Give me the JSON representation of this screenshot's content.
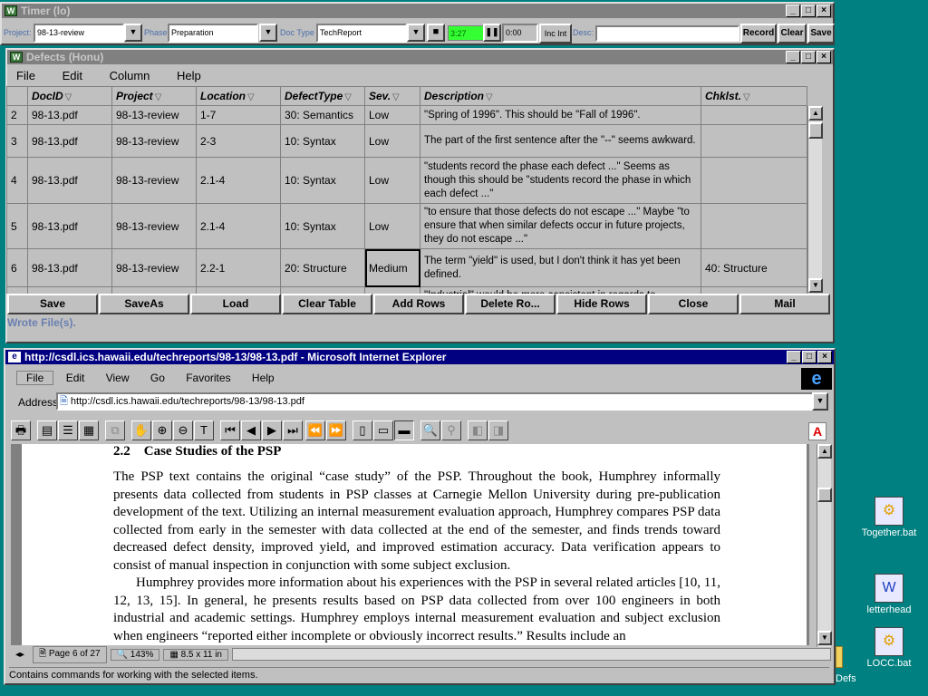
{
  "timer": {
    "title": "Timer (lo)",
    "project_label": "Project:",
    "project_value": "98-13-review",
    "phase_label": "Phase",
    "phase_value": "Preparation",
    "doctype_label": "Doc Type",
    "doctype_value": "TechReport",
    "elapsed": "3:27",
    "pause_time": "0:00",
    "inc_int": "Inc Int",
    "desc_label": "Desc:",
    "desc_value": "",
    "record": "Record",
    "clear": "Clear",
    "save": "Save"
  },
  "defects": {
    "title": "Defects (Honu)",
    "menu": [
      "File",
      "Edit",
      "Column",
      "Help"
    ],
    "columns": [
      "DocID",
      "Project",
      "Location",
      "DefectType",
      "Sev.",
      "Description",
      "Chklst."
    ],
    "rows": [
      {
        "n": "2",
        "doc": "98-13.pdf",
        "proj": "98-13-review",
        "loc": "1-7",
        "type": "30: Semantics",
        "sev": "Low",
        "desc": "\"Spring of 1996\".  This should be \"Fall of 1996\".",
        "chk": ""
      },
      {
        "n": "3",
        "doc": "98-13.pdf",
        "proj": "98-13-review",
        "loc": "2-3",
        "type": "10: Syntax",
        "sev": "Low",
        "desc": "The part of the first sentence after the \"--\" seems awkward.",
        "chk": ""
      },
      {
        "n": "4",
        "doc": "98-13.pdf",
        "proj": "98-13-review",
        "loc": "2.1-4",
        "type": "10: Syntax",
        "sev": "Low",
        "desc": "\"students record the phase each defect ...\"  Seems as though this should be \"students record the phase in which each defect ...\"",
        "chk": ""
      },
      {
        "n": "5",
        "doc": "98-13.pdf",
        "proj": "98-13-review",
        "loc": "2.1-4",
        "type": "10: Syntax",
        "sev": "Low",
        "desc": "\"to ensure that those defects do not escape ...\"   Maybe \"to ensure that when similar defects occur in future projects, they do not escape ...\"",
        "chk": ""
      },
      {
        "n": "6",
        "doc": "98-13.pdf",
        "proj": "98-13-review",
        "loc": "2.2-1",
        "type": "20: Structure",
        "sev": "Medium",
        "desc": "The term \"yield\" is used, but I don't think it has yet been defined.",
        "chk": "40: Structure"
      },
      {
        "n": "",
        "doc": "",
        "proj": "",
        "loc": "",
        "type": "",
        "sev": "",
        "desc": "\"Industrial\" would be more consistent in regards to",
        "chk": ""
      }
    ],
    "buttons": [
      "Save",
      "SaveAs",
      "Load",
      "Clear Table",
      "Add Rows",
      "Delete Ro...",
      "Hide Rows",
      "Close",
      "Mail"
    ],
    "status": "Wrote File(s)."
  },
  "ie": {
    "title": "http://csdl.ics.hawaii.edu/techreports/98-13/98-13.pdf - Microsoft Internet Explorer",
    "menu": [
      "File",
      "Edit",
      "View",
      "Go",
      "Favorites",
      "Help"
    ],
    "address_label": "Address",
    "address": "http://csdl.ics.hawaii.edu/techreports/98-13/98-13.pdf",
    "page_label": "Page 6 of 27",
    "zoom": "143%",
    "paper_size": "8.5 x 11 in",
    "status": "Contains commands for working with the selected items.",
    "doc": {
      "section_num": "2.2",
      "section_title": "Case Studies of the PSP",
      "p1": "The PSP text contains the original “case study” of the PSP. Throughout the book, Humphrey informally presents data collected from students in PSP classes at Carnegie Mellon University during pre-publication development of the text. Utilizing an internal measurement evaluation approach, Humphrey compares PSP data collected from early in the semester with data collected at the end of the semester, and finds trends toward decreased defect density, improved yield, and improved estimation accuracy. Data verification appears to consist of manual inspection in conjunction with some subject exclusion.",
      "p2": "Humphrey provides more information about his experiences with the PSP in several related articles [10, 11, 12, 13, 15]. In general, he presents results based on PSP data collected from over 100 engineers in both industrial and academic settings. Humphrey employs internal measurement evaluation and subject exclusion when engineers “reported either incomplete or obviously incorrect results.” Results include an"
    }
  },
  "desktop": {
    "icons": [
      "Together.bat",
      "letterhead",
      "LOCC.bat"
    ],
    "partial": "Defs"
  }
}
